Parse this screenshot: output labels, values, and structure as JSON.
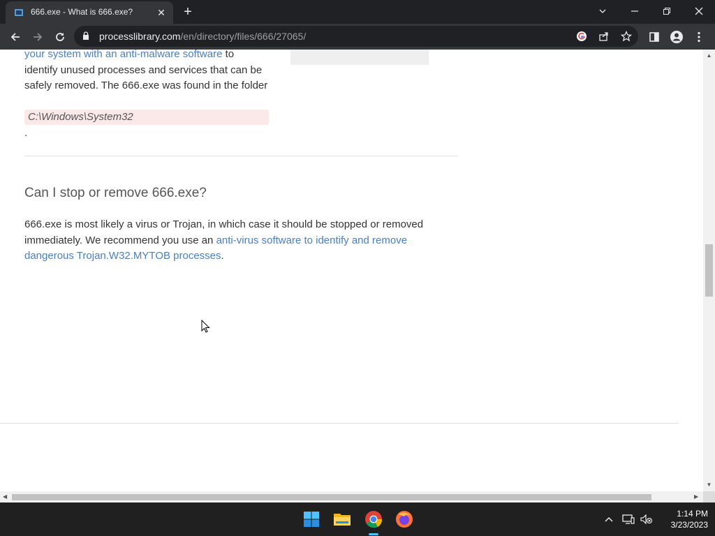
{
  "browser": {
    "tab": {
      "title": "666.exe - What is 666.exe?"
    },
    "url": {
      "host": "processlibrary.com",
      "path": "/en/directory/files/666/27065/"
    }
  },
  "page": {
    "para1": {
      "link": "your system with an anti-malware software",
      "text_after_link": " to identify unused processes and services that can be safely removed. The 666.exe was found in the folder"
    },
    "folder_path": "C:\\Windows\\System32",
    "period": ".",
    "heading": "Can I stop or remove 666.exe?",
    "para2": {
      "text_before": "666.exe is most likely a virus or Trojan, in which case it should be stopped or removed immediately. We recommend you use an ",
      "link": "anti-virus software to identify and remove dangerous Trojan.W32.MYTOB processes",
      "text_after": "."
    }
  },
  "taskbar": {
    "apps": [
      "start-icon",
      "file-explorer-icon",
      "chrome-icon",
      "firefox-icon"
    ],
    "time": "1:14 PM",
    "date": "3/23/2023"
  },
  "colors": {
    "link": "#4a7fc1",
    "path_bg": "#fbe9e9",
    "chrome_dark": "#202124",
    "taskbar": "#202020"
  }
}
